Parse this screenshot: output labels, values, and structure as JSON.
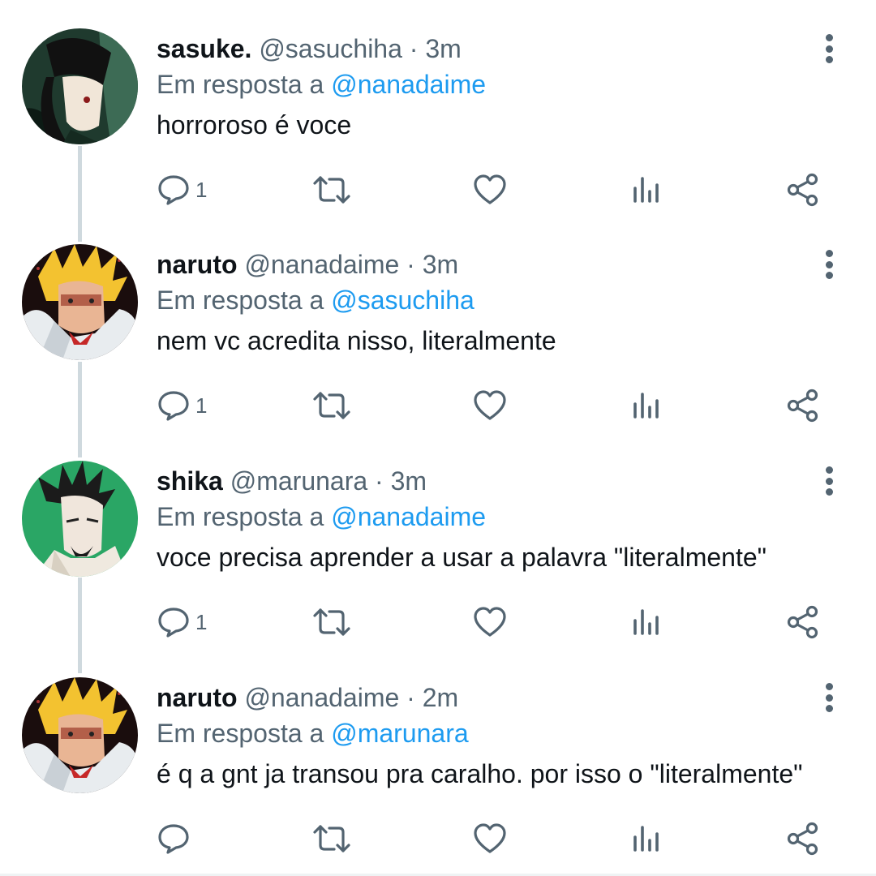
{
  "colors": {
    "accent": "#1d9bf0",
    "text": "#0f1419",
    "muted": "#536471"
  },
  "icons": {
    "reply": "reply-icon",
    "retweet": "retweet-icon",
    "like": "heart-icon",
    "views": "views-icon",
    "share": "share-icon",
    "more": "more-icon"
  },
  "tweets": [
    {
      "name": "sasuke.",
      "handle": "@sasuchiha",
      "time": "· 3m",
      "reply_prefix": "Em resposta a",
      "reply_to": "@nanadaime",
      "text": "horroroso é voce",
      "reply_count": "1"
    },
    {
      "name": "naruto",
      "handle": "@nanadaime",
      "time": "· 3m",
      "reply_prefix": "Em resposta a",
      "reply_to": "@sasuchiha",
      "text": "nem vc acredita nisso, literalmente",
      "reply_count": "1"
    },
    {
      "name": "shika",
      "handle": "@marunara",
      "time": "· 3m",
      "reply_prefix": "Em resposta a",
      "reply_to": "@nanadaime",
      "text": "voce precisa aprender a usar a palavra \"literalmente\"",
      "reply_count": "1"
    },
    {
      "name": "naruto",
      "handle": "@nanadaime",
      "time": "· 2m",
      "reply_prefix": "Em resposta a",
      "reply_to": "@marunara",
      "text": "é q a gnt ja transou pra caralho. por isso o \"literalmente\"",
      "reply_count": ""
    }
  ]
}
